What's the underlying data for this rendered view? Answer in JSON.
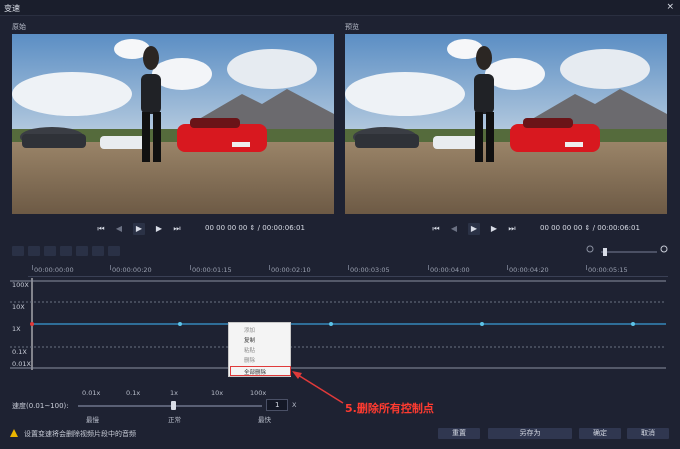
{
  "window": {
    "title": "变速",
    "close_glyph": "×"
  },
  "panels": {
    "original_label": "原始",
    "preview_label": "预览"
  },
  "left_player": {
    "timecode": "00 00 00 00",
    "duration": "/ 00:00:06:01"
  },
  "right_player": {
    "timecode": "00 00 00 00",
    "duration": "/ 00:00:06:01"
  },
  "ruler": {
    "ticks": [
      "00:00:00:00",
      "00:00:00:20",
      "00:00:01:15",
      "00:00:02:10",
      "00:00:03:05",
      "00:00:04:00",
      "00:00:04:20",
      "00:00:05:15"
    ]
  },
  "graph": {
    "y_labels": [
      "100X",
      "10X",
      "1X",
      "0.1X",
      "0.01X"
    ]
  },
  "context_menu": {
    "items": [
      "添加",
      "复制",
      "粘贴",
      "删除",
      "全部删除"
    ]
  },
  "speed": {
    "label": "速度(0.01~100):",
    "scale_top": [
      "0.01x",
      "0.1x",
      "1x",
      "10x",
      "100x"
    ],
    "scale_bottom": [
      "最慢",
      "正常",
      "最快"
    ],
    "value": "1",
    "unit": "X"
  },
  "annotation": "5.删除所有控制点",
  "status": {
    "message": "设置变速将会删除视频片段中的音频"
  },
  "buttons": {
    "reset": "重置",
    "save_as": "另存为",
    "ok": "确定",
    "cancel": "取消"
  },
  "colors": {
    "accent_line": "#3a9bd5",
    "highlight": "#e03a3a",
    "annotation": "#ff3b30"
  }
}
